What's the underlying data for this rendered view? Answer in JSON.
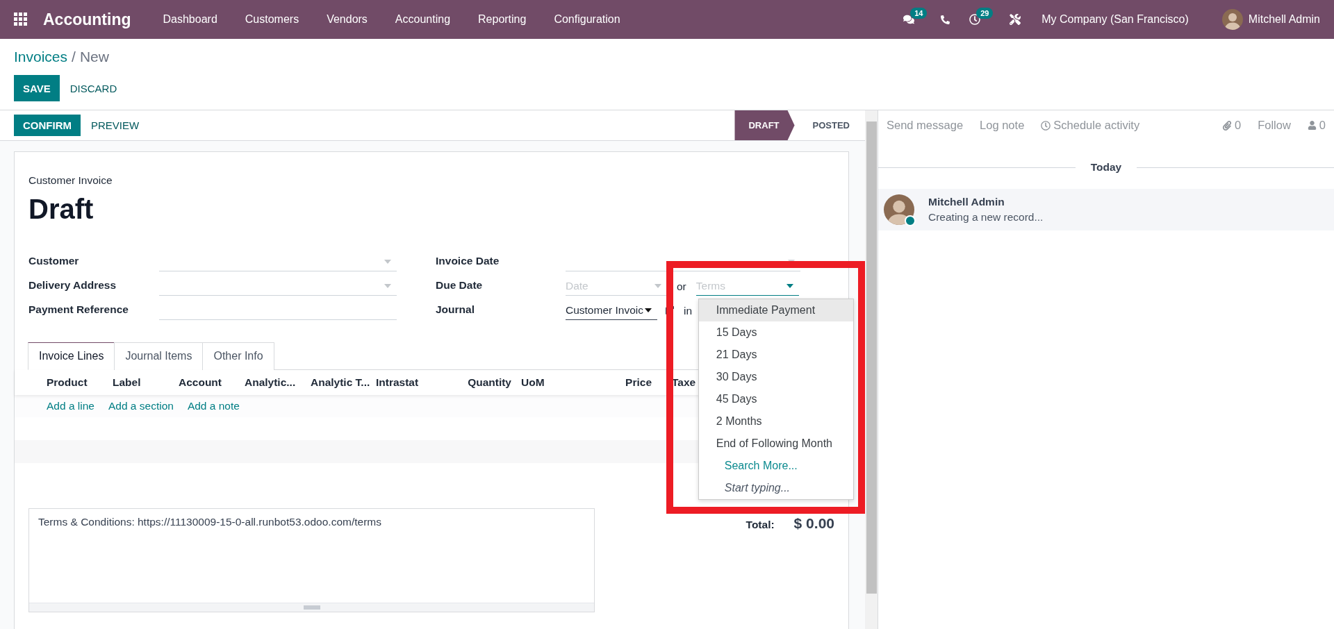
{
  "navbar": {
    "app": "Accounting",
    "menu": [
      "Dashboard",
      "Customers",
      "Vendors",
      "Accounting",
      "Reporting",
      "Configuration"
    ],
    "messages_count": "14",
    "activities_count": "29",
    "company": "My Company (San Francisco)",
    "user": "Mitchell Admin"
  },
  "breadcrumb": {
    "parent": "Invoices",
    "separator": "/",
    "current": "New"
  },
  "actions": [
    {
      "label": "SAVE",
      "kind": "primary"
    },
    {
      "label": "DISCARD",
      "kind": "link"
    }
  ],
  "header_buttons": [
    {
      "label": "CONFIRM",
      "kind": "primary"
    },
    {
      "label": "PREVIEW",
      "kind": "link"
    }
  ],
  "status": [
    {
      "label": "DRAFT",
      "selected": true
    },
    {
      "label": "POSTED",
      "selected": false
    }
  ],
  "form": {
    "type": "Customer Invoice",
    "name": "Draft",
    "left_fields": [
      {
        "label": "Customer",
        "kind": "select"
      },
      {
        "label": "Delivery Address",
        "kind": "select"
      },
      {
        "label": "Payment Reference",
        "kind": "text"
      }
    ],
    "invoice_date": {
      "label": "Invoice Date"
    },
    "due_date": {
      "label": "Due Date",
      "date_placeholder": "Date",
      "or": "or",
      "terms_placeholder": "Terms"
    },
    "journal": {
      "label": "Journal",
      "value": "Customer Invoic",
      "currency": "in"
    },
    "tabs": [
      {
        "label": "Invoice Lines",
        "selected": true
      },
      {
        "label": "Journal Items",
        "selected": false
      },
      {
        "label": "Other Info",
        "selected": false
      }
    ],
    "columns": [
      "Product",
      "Label",
      "Account",
      "Analytic...",
      "Analytic T...",
      "Intrastat",
      "Quantity",
      "UoM",
      "Price",
      "Taxe"
    ],
    "add_links": [
      "Add a line",
      "Add a section",
      "Add a note"
    ],
    "terms": "Terms & Conditions: https://11130009-15-0-all.runbot53.odoo.com/terms",
    "total_label": "Total:",
    "total_value": "$ 0.00"
  },
  "terms_dropdown": [
    {
      "label": "Immediate Payment",
      "kind": "option",
      "selected": true
    },
    {
      "label": "15 Days",
      "kind": "option",
      "selected": false
    },
    {
      "label": "21 Days",
      "kind": "option",
      "selected": false
    },
    {
      "label": "30 Days",
      "kind": "option",
      "selected": false
    },
    {
      "label": "45 Days",
      "kind": "option",
      "selected": false
    },
    {
      "label": "2 Months",
      "kind": "option",
      "selected": false
    },
    {
      "label": "End of Following Month",
      "kind": "option",
      "selected": false
    },
    {
      "label": "Search More...",
      "kind": "search_more",
      "selected": false
    },
    {
      "label": "Start typing...",
      "kind": "hint",
      "selected": false
    }
  ],
  "chatter": {
    "send_message": "Send message",
    "log_note": "Log note",
    "schedule_activity": "Schedule activity",
    "attachments": "0",
    "follow": "Follow",
    "followers": "0",
    "date_divider": "Today",
    "messages": [
      {
        "author": "Mitchell Admin",
        "body": "Creating a new record..."
      }
    ]
  }
}
